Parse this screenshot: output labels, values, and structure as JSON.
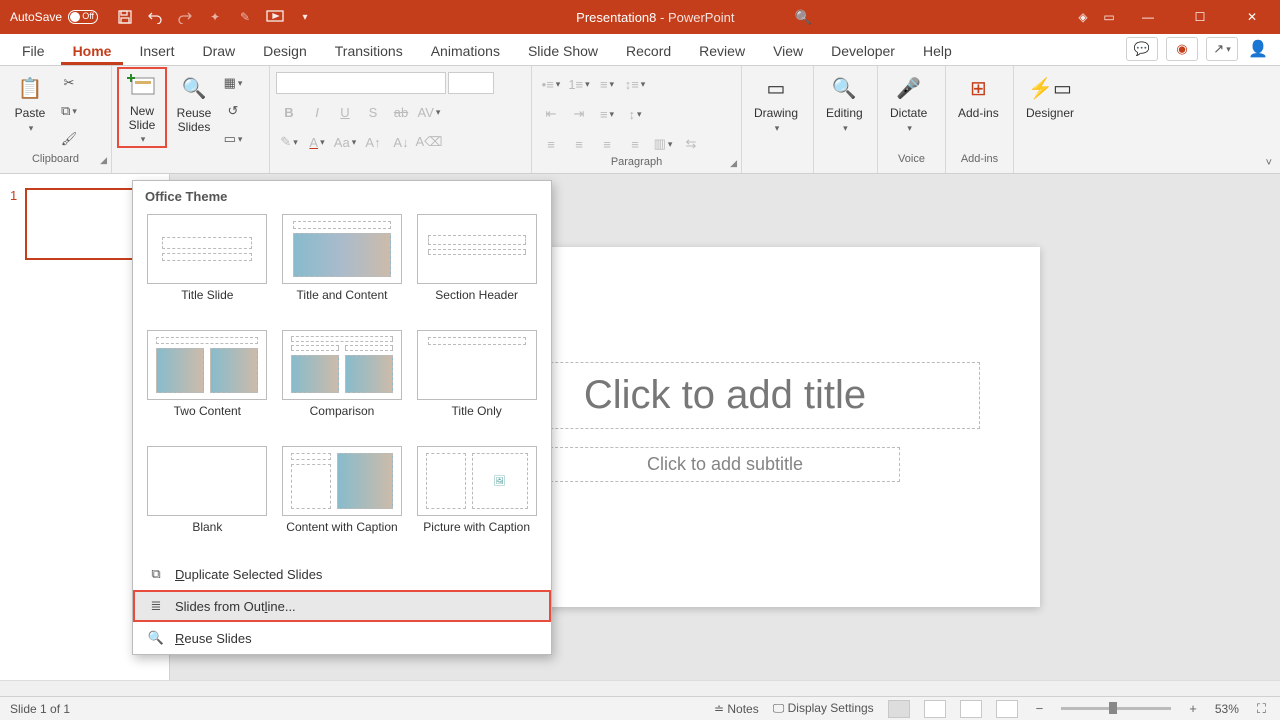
{
  "title": {
    "autosave": "AutoSave",
    "toggle": "Off",
    "doc": "Presentation8",
    "sep": "  -  ",
    "app": "PowerPoint"
  },
  "tabs": [
    "File",
    "Home",
    "Insert",
    "Draw",
    "Design",
    "Transitions",
    "Animations",
    "Slide Show",
    "Record",
    "Review",
    "View",
    "Developer",
    "Help"
  ],
  "active_tab": 1,
  "ribbon": {
    "clipboard": {
      "label": "Clipboard",
      "paste": "Paste"
    },
    "slides": {
      "new": "New\nSlide",
      "reuse": "Reuse\nSlides"
    },
    "paragraph": {
      "label": "Paragraph"
    },
    "drawing": "Drawing",
    "editing": "Editing",
    "dictate": "Dictate",
    "voice": "Voice",
    "addins": "Add-ins",
    "addins_grp": "Add-ins",
    "designer": "Designer"
  },
  "dropdown": {
    "header": "Office Theme",
    "layouts": [
      "Title Slide",
      "Title and Content",
      "Section Header",
      "Two Content",
      "Comparison",
      "Title Only",
      "Blank",
      "Content with Caption",
      "Picture with Caption"
    ],
    "dup": "uplicate Selected Slides",
    "outline": "Slides from Out",
    "outline2": "ine...",
    "reuse": "euse Slides"
  },
  "canvas": {
    "title": "Click to add title",
    "subtitle": "Click to add subtitle"
  },
  "thumb": {
    "num": "1"
  },
  "status": {
    "slide": "Slide 1 of 1",
    "notes": "Notes",
    "display": "Display Settings",
    "zoom": "53%"
  }
}
